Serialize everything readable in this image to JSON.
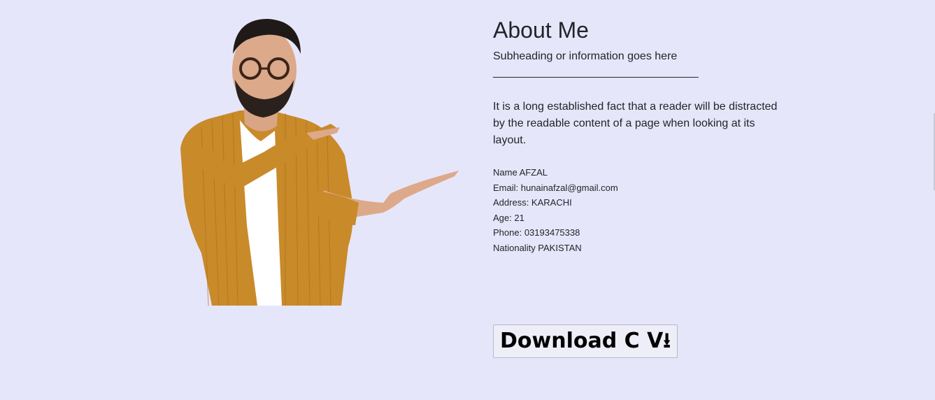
{
  "about": {
    "title": "About Me",
    "subheading": "Subheading or information goes here",
    "divider": "_________________________________",
    "description": "It is a long established fact that a reader will be distracted by the readable content of a page when looking at its layout."
  },
  "details": [
    {
      "text": "Name AFZAL"
    },
    {
      "text": "Email: hunainafzal@gmail.com"
    },
    {
      "text": "Address: KARACHI"
    },
    {
      "text": "Age: 21"
    },
    {
      "text": "Phone: 03193475338"
    },
    {
      "text": "Nationality PAKISTAN"
    }
  ],
  "cv": {
    "label": "Download C V⭳"
  },
  "colors": {
    "background": "#e6e6fa",
    "jacket": "#c98a2a",
    "shirt": "#ffffff"
  }
}
